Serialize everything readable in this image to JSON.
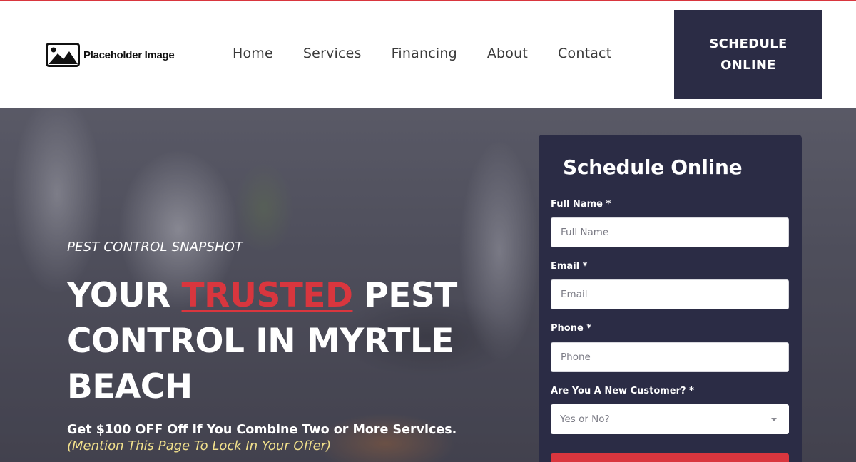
{
  "logo": {
    "text": "Placeholder Image",
    "icon": "image-icon"
  },
  "nav": {
    "items": [
      {
        "label": "Home"
      },
      {
        "label": "Services"
      },
      {
        "label": "Financing"
      },
      {
        "label": "About"
      },
      {
        "label": "Contact"
      }
    ]
  },
  "cta": {
    "label": "SCHEDULE ONLINE"
  },
  "hero": {
    "eyebrow": "PEST CONTROL SNAPSHOT",
    "headline_pre": "YOUR ",
    "headline_accent": "TRUSTED",
    "headline_post": " PEST CONTROL IN MYRTLE BEACH",
    "offer": "Get $100 OFF Off If You Combine Two or More Services.",
    "mention": "(Mention This Page To Lock In Your Offer)"
  },
  "form": {
    "title": "Schedule Online",
    "full_name": {
      "label": "Full Name *",
      "placeholder": "Full Name",
      "value": ""
    },
    "email": {
      "label": "Email *",
      "placeholder": "Email",
      "value": ""
    },
    "phone": {
      "label": "Phone *",
      "placeholder": "Phone",
      "value": ""
    },
    "new_customer": {
      "label": "Are You A New Customer? *",
      "selected": "Yes or No?"
    }
  },
  "colors": {
    "brand_dark": "#2b2c45",
    "accent_red": "#d9363e",
    "mention_yellow": "#f1e08c"
  }
}
